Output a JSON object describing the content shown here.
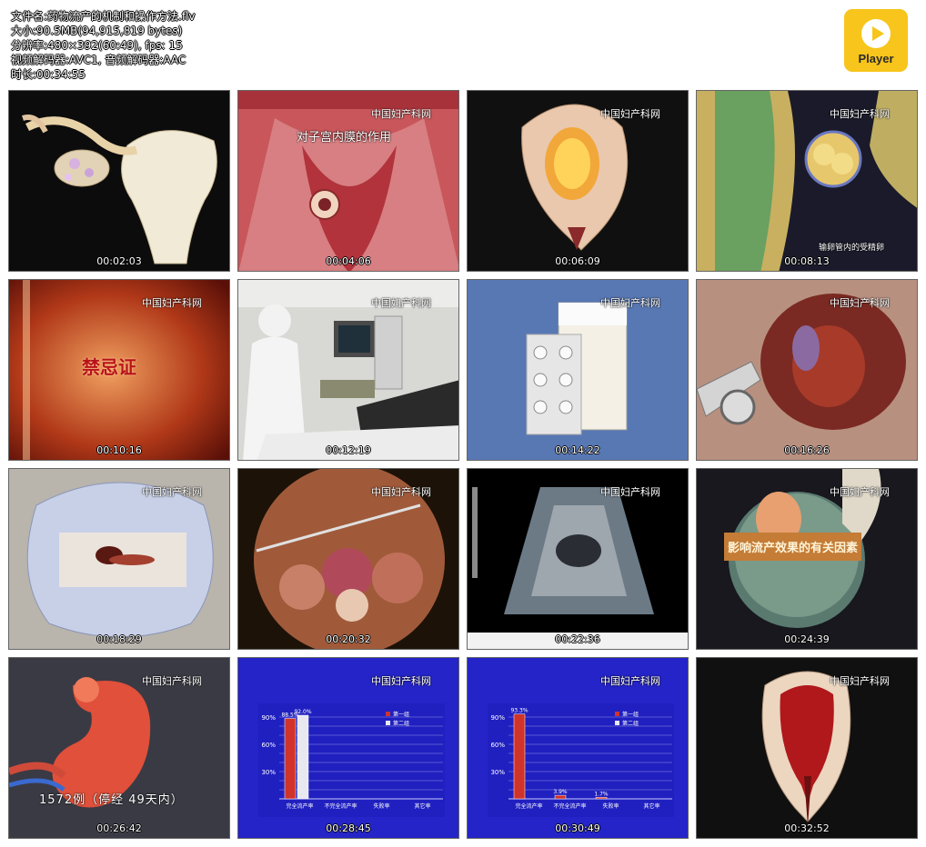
{
  "file_info": {
    "filename": "文件名:药物流产的机制和操作方法.flv",
    "size": "大小:90.5MB(94,915,819 bytes)",
    "resolution": "分辨率:480×392(60:49), fps: 15",
    "codecs": "视频解码器:AVC1, 音频解码器:AAC",
    "duration": "时长:00:34:55"
  },
  "logo": {
    "label": "Player",
    "icon": "play-icon",
    "color": "#f7c51b"
  },
  "watermark": "中国妇产科网",
  "thumbnails": [
    {
      "time": "00:02:03",
      "caption": ""
    },
    {
      "time": "00:04:06",
      "caption": "对子宫内膜的作用"
    },
    {
      "time": "00:06:09",
      "caption": ""
    },
    {
      "time": "00:08:13",
      "caption": "输卵管内的受精卵"
    },
    {
      "time": "00:10:16",
      "caption": "禁忌证"
    },
    {
      "time": "00:12:19",
      "caption": ""
    },
    {
      "time": "00:14:22",
      "caption": ""
    },
    {
      "time": "00:16:26",
      "caption": ""
    },
    {
      "time": "00:18:29",
      "caption": ""
    },
    {
      "time": "00:20:32",
      "caption": ""
    },
    {
      "time": "00:22:36",
      "caption": ""
    },
    {
      "time": "00:24:39",
      "caption": "影响流产效果的有关因素"
    },
    {
      "time": "00:26:42",
      "caption": "1572例（停经 49天内）"
    },
    {
      "time": "00:28:45",
      "caption": ""
    },
    {
      "time": "00:30:49",
      "caption": ""
    },
    {
      "time": "00:32:52",
      "caption": ""
    }
  ],
  "charts": [
    {
      "type": "bar",
      "y_ticks": [
        "90%",
        "60%",
        "30%"
      ],
      "categories": [
        "完全流产率",
        "不完全流产率",
        "失败率",
        "其它率"
      ],
      "series": [
        {
          "name": "第一组",
          "values": [
            88.5,
            0,
            0,
            0
          ],
          "labels": [
            "88.5%",
            "",
            "",
            ""
          ],
          "color": "#d0332a"
        },
        {
          "name": "第二组",
          "values": [
            92.0,
            0,
            0,
            0
          ],
          "labels": [
            "92.0%",
            "",
            "",
            ""
          ],
          "color": "#e8e8f0"
        }
      ]
    },
    {
      "type": "bar",
      "y_ticks": [
        "90%",
        "60%",
        "30%"
      ],
      "categories": [
        "完全流产率",
        "不完全流产率",
        "失败率",
        "其它率"
      ],
      "series": [
        {
          "name": "第一组",
          "values": [
            93.3,
            3.9,
            1.7,
            0
          ],
          "labels": [
            "93.3%",
            "3.9%",
            "1.7%",
            ""
          ],
          "color": "#d0332a"
        },
        {
          "name": "第二组",
          "values": [
            0,
            0,
            0,
            0
          ],
          "labels": [
            "",
            "",
            "",
            ""
          ],
          "color": "#e8e8f0"
        }
      ]
    }
  ]
}
